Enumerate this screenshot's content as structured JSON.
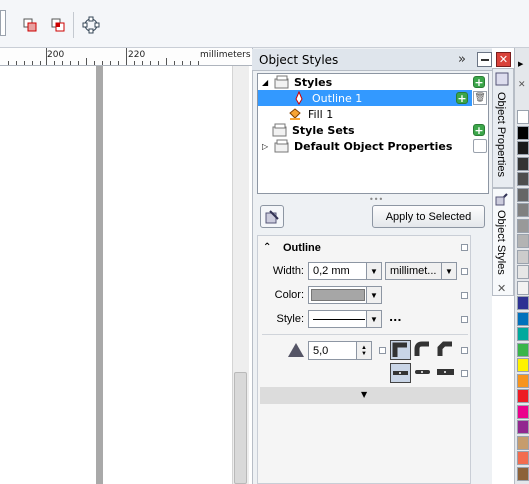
{
  "ruler": {
    "label_200": "200",
    "label_220": "220",
    "unit": "millimeters"
  },
  "docker": {
    "title": "Object Styles",
    "tree": {
      "styles": "Styles",
      "outline": "Outline 1",
      "fill": "Fill 1",
      "style_sets": "Style Sets",
      "default_props": "Default Object Properties"
    },
    "apply_button": "Apply to Selected",
    "outline_section": {
      "heading": "Outline",
      "width_label": "Width:",
      "width_value": "0,2 mm",
      "unit_value": "millimet...",
      "color_label": "Color:",
      "style_label": "Style:",
      "miter_value": "5,0",
      "more": "..."
    }
  },
  "side_tabs": {
    "object_properties": "Object Properties",
    "object_styles": "Object Styles"
  },
  "palette": [
    "#ffffff",
    "#000000",
    "#1a1a1a",
    "#333333",
    "#4d4d4d",
    "#666666",
    "#808080",
    "#999999",
    "#b3b3b3",
    "#cccccc",
    "#e6e6e6",
    "#f2f2f2",
    "#2e3192",
    "#0071bc",
    "#00a99d",
    "#39b54a",
    "#fff200",
    "#f7941d",
    "#ed1c24",
    "#ec008c",
    "#92278f",
    "#c69c6d",
    "#f26c4f",
    "#8c6239"
  ]
}
